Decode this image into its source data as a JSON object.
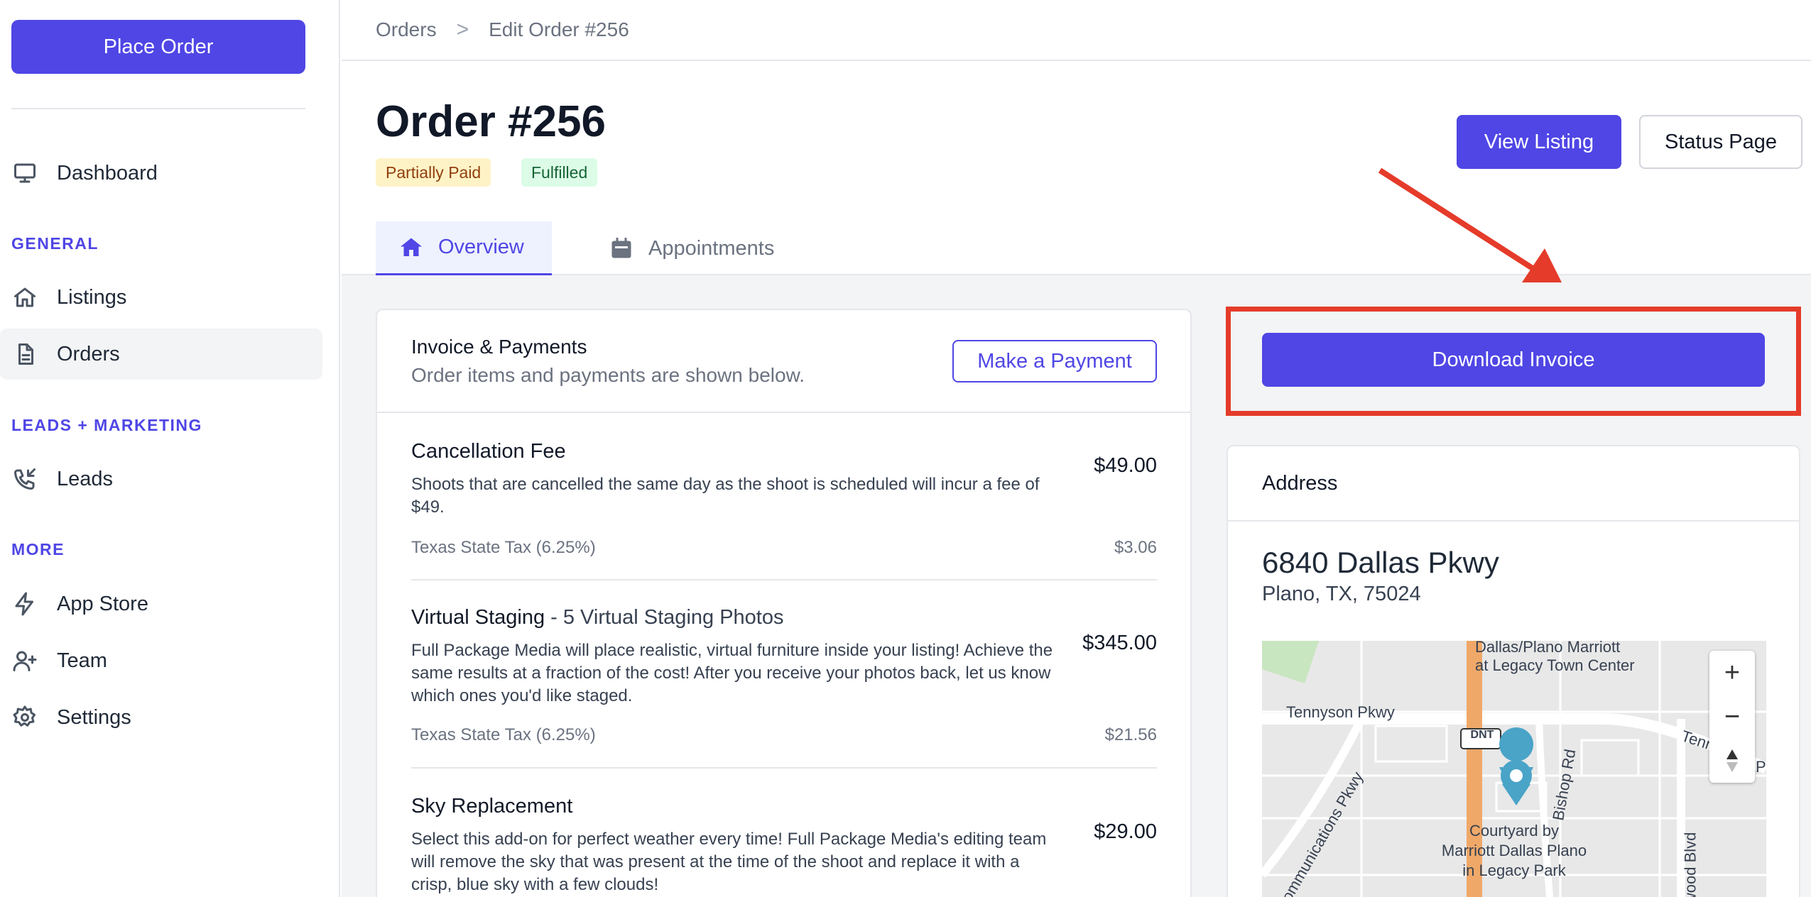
{
  "sidebar": {
    "place_order": "Place Order",
    "dashboard": "Dashboard",
    "sections": {
      "general": "GENERAL",
      "leads_marketing": "LEADS + MARKETING",
      "more": "MORE"
    },
    "items": {
      "listings": "Listings",
      "orders": "Orders",
      "leads": "Leads",
      "app_store": "App Store",
      "team": "Team",
      "settings": "Settings"
    }
  },
  "breadcrumb": {
    "root": "Orders",
    "separator": ">",
    "current": "Edit Order #256"
  },
  "order": {
    "title": "Order #256",
    "badges": {
      "payment": "Partially Paid",
      "fulfillment": "Fulfilled"
    },
    "view_listing": "View Listing",
    "status_page": "Status Page"
  },
  "tabs": {
    "overview": "Overview",
    "appointments": "Appointments"
  },
  "invoice": {
    "title": "Invoice & Payments",
    "subtitle": "Order items and payments are shown below.",
    "make_payment": "Make a Payment",
    "items": [
      {
        "name": "Cancellation Fee",
        "variant": "",
        "description": "Shoots that are cancelled the same day as the shoot is scheduled will incur a fee of $49.",
        "price": "$49.00",
        "tax_label": "Texas State Tax (6.25%)",
        "tax": "$3.06"
      },
      {
        "name": "Virtual Staging",
        "variant": " - 5 Virtual Staging Photos",
        "description": "Full Package Media will place realistic, virtual furniture inside your listing! Achieve the same results at a fraction of the cost! After you receive your photos back, let us know which ones you'd like staged.",
        "price": "$345.00",
        "tax_label": "Texas State Tax (6.25%)",
        "tax": "$21.56"
      },
      {
        "name": "Sky Replacement",
        "variant": "",
        "description": "Select this add-on for perfect weather every time! Full Package Media's editing team will remove the sky that was present at the time of the shoot and replace it with a crisp, blue sky with a few clouds!",
        "price": "$29.00"
      }
    ]
  },
  "download_invoice": "Download Invoice",
  "address": {
    "label": "Address",
    "line1": "6840 Dallas Pkwy",
    "line2": "Plano, TX, 75024",
    "map_labels": {
      "marriott_top_1": "Dallas/Plano Marriott",
      "marriott_top_2": "at Legacy Town Center",
      "tennyson": "Tennyson Pkwy",
      "tennyson_right": "Tenn",
      "tennyson_right_p": "P",
      "dnt": "DNT",
      "communications": "Communications Pkwy",
      "bishop": "Bishop Rd",
      "parkwood": "Parkwood Blvd",
      "courtyard_1": "Courtyard by",
      "courtyard_2": "Marriott Dallas Plano",
      "courtyard_3": "in Legacy Park"
    },
    "zoom_in": "+",
    "zoom_out": "−"
  },
  "colors": {
    "accent": "#4f46e5",
    "highlight": "#e53b2a",
    "badge_partial_bg": "#fef3c7",
    "badge_fulfilled_bg": "#dcfce7"
  }
}
